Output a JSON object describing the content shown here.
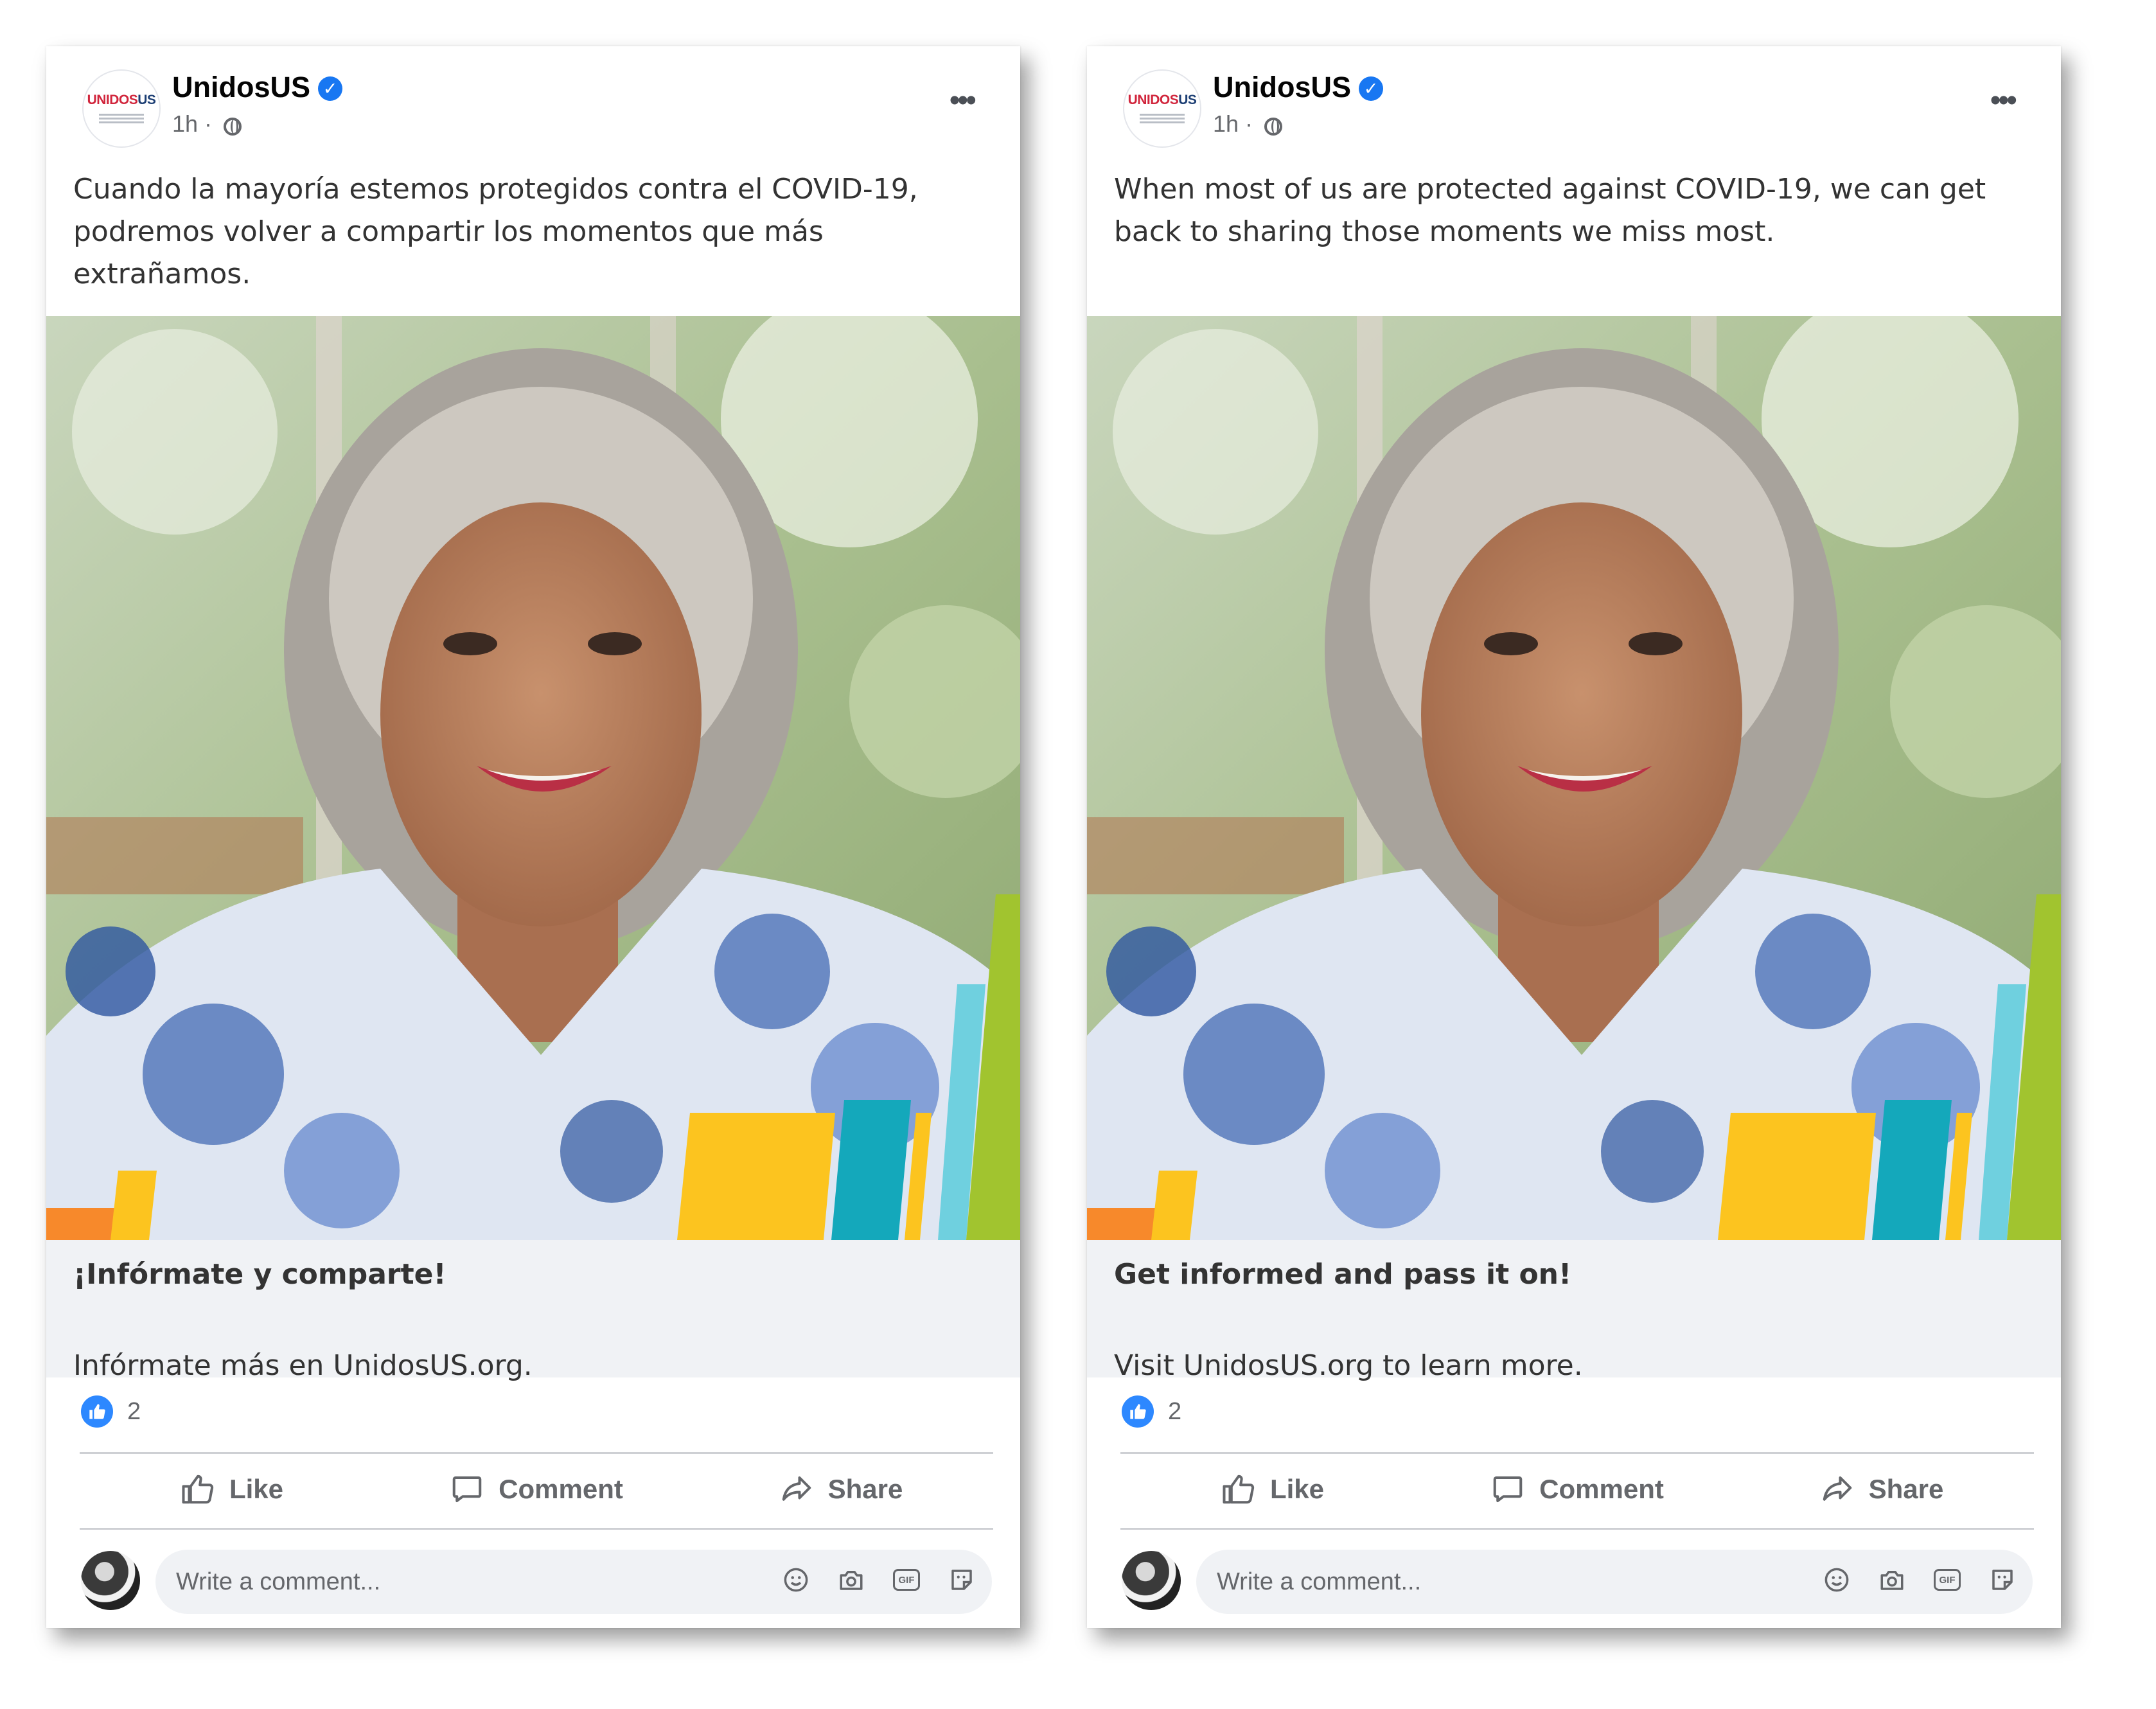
{
  "posts": [
    {
      "page_name": "UnidosUS",
      "time": "1h ·",
      "logo": {
        "word_a": "UNIDOS",
        "word_b": "US"
      },
      "caption": "Cuando la mayoría estemos protegidos contra el COVID-19, podremos volver a compartir los momentos que más extrañamos.",
      "link_headline": "¡Infórmate y comparte!",
      "link_description": "Infórmate más en UnidosUS.org.",
      "reaction_count": "2",
      "actions": {
        "like": "Like",
        "comment": "Comment",
        "share": "Share"
      },
      "comment_placeholder": "Write a comment..."
    },
    {
      "page_name": "UnidosUS",
      "time": "1h ·",
      "logo": {
        "word_a": "UNIDOS",
        "word_b": "US"
      },
      "caption": "When most of us are protected against COVID-19, we can get back to sharing those moments we miss most.",
      "link_headline": "Get informed and pass it on!",
      "link_description": "Visit UnidosUS.org to learn more.",
      "reaction_count": "2",
      "actions": {
        "like": "Like",
        "comment": "Comment",
        "share": "Share"
      },
      "comment_placeholder": "Write a comment..."
    }
  ],
  "icons": {
    "verified": "verified-badge-icon",
    "audience": "globe-icon",
    "menu": "more-options-icon",
    "reaction": "like-reaction-icon",
    "like": "thumbs-up-icon",
    "comment": "speech-bubble-icon",
    "share": "share-arrow-icon",
    "emoji": "smiley-icon",
    "camera": "camera-icon",
    "gif": "gif-icon",
    "sticker": "sticker-icon"
  },
  "colors": {
    "facebook_blue": "#1877f2",
    "reaction_blue": "#2d88ff",
    "muted_text": "#65676b",
    "link_box_bg": "#f0f2f5",
    "brand_orange": "#f7892b",
    "brand_yellow": "#fcc41f",
    "brand_teal": "#14a8bb",
    "brand_light_blue": "#6fd0df",
    "brand_green": "#a1c42f"
  }
}
